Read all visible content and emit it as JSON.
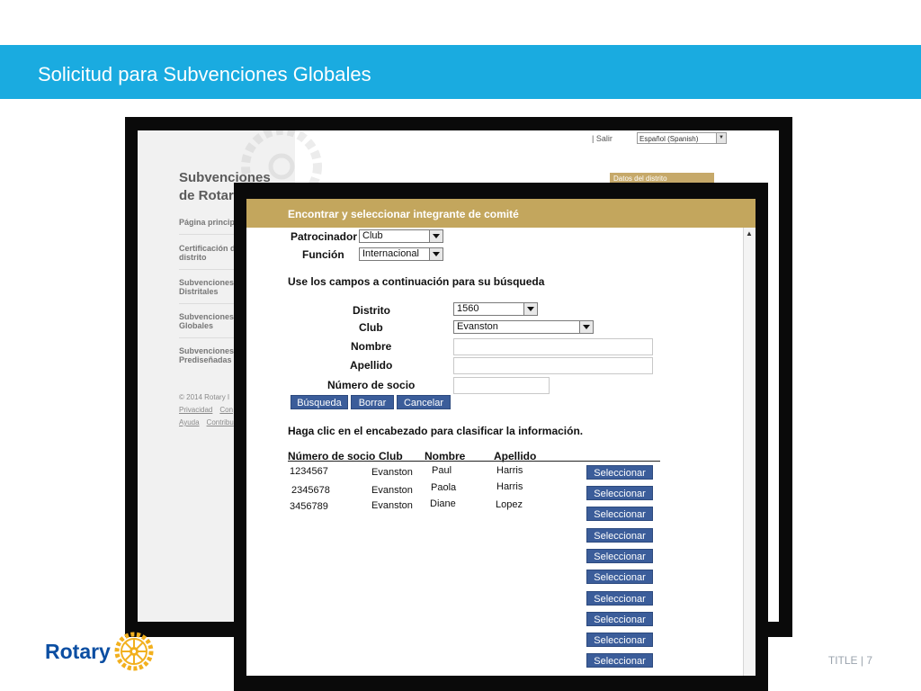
{
  "slide": {
    "title": "Solicitud para Subvenciones Globales",
    "footer": "TITLE  |  7",
    "logo_text": "Rotary"
  },
  "colors": {
    "header_band": "#1aabe0",
    "dialog_titlebar": "#c3a65d",
    "button": "#3b5d9a",
    "rotary_blue": "#0b4ea2",
    "rotary_gold": "#f2b01e"
  },
  "back_window": {
    "salir": "|  Salir",
    "language": "Español (Spanish)",
    "brand_line1": "Subvenciones",
    "brand_line2": "de Rotar",
    "gold_panel": "Datos del distrito",
    "nav": [
      "Página princip",
      "Certificación d",
      "distrito",
      "Subvenciones",
      "Distritales",
      "Subvenciones",
      "Globales",
      "Subvenciones",
      "Prediseñadas"
    ],
    "copyright": "© 2014 Rotary I",
    "links": [
      "Privacidad",
      "Con",
      "Ayuda",
      "Contribu"
    ]
  },
  "dialog": {
    "title": "Encontrar y seleccionar integrante de comité",
    "patrocinador_label": "Patrocinador",
    "patrocinador_value": "Club",
    "funcion_label": "Función",
    "funcion_value": "Internacional",
    "instruction": "Use los campos a continuación para su búsqueda",
    "distrito_label": "Distrito",
    "distrito_value": "1560",
    "club_label": "Club",
    "club_value": "Evanston",
    "nombre_label": "Nombre",
    "apellido_label": "Apellido",
    "socio_label": "Número de socio",
    "buttons": {
      "search": "Búsqueda",
      "clear": "Borrar",
      "cancel": "Cancelar"
    },
    "sort_hint": "Haga clic en el encabezado para clasificar la información.",
    "table": {
      "headers": [
        "Número de socio",
        "Club",
        "Nombre",
        "Apellido"
      ],
      "rows": [
        [
          "1234567",
          "Evanston",
          "Paul",
          "Harris"
        ],
        [
          "2345678",
          "Evanston",
          "Paola",
          "Harris"
        ],
        [
          "3456789",
          "Evanston",
          "Diane",
          "Lopez"
        ]
      ],
      "select_label": "Seleccionar",
      "select_buttons_count": 10
    }
  }
}
